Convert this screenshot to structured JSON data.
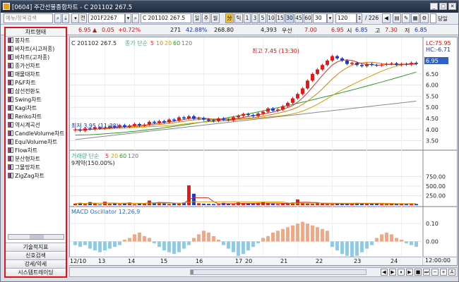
{
  "window": {
    "title": "[0604] 주간선물종합차트 - C 201102 267.5"
  },
  "toolbar": {
    "search_placeholder": "예뉴/항목검색",
    "mode_label": "전",
    "code_value": "201F2267",
    "name_value": "C 201102 267.5",
    "periods": [
      "일",
      "주",
      "월",
      "틱",
      "1",
      "3",
      "5",
      "10",
      "15",
      "30",
      "45",
      "60",
      "30"
    ],
    "count_value": "120",
    "total_count": "/ 226",
    "check_label": "당일"
  },
  "pricebar": {
    "price": "6.95",
    "change_arrow": "▲",
    "change": "0.05",
    "change_pct": "+0.72%",
    "volume": "271",
    "vol_pct": "42.88%",
    "amount": "268.80",
    "open_interest": "4,393",
    "priority_label": "우선",
    "priority_value": "7.00",
    "bid_value": "6.95",
    "low_label": "시",
    "low_value": "6.85",
    "high_label": "고",
    "high_value": "7.30",
    "close_label": "저",
    "close_value": "6.85"
  },
  "left_panel": {
    "header": "차트형태",
    "items": [
      "봉차트",
      "바차트(시고저종)",
      "바차트(고저종)",
      "종가선차트",
      "매물대차트",
      "P&F차트",
      "삼선전환도",
      "Swing차트",
      "Kagi차트",
      "Renko차트",
      "역시계곡선",
      "CandleVolume차트",
      "EquiVolume차트",
      "Flow차트",
      "분산형차트",
      "그물망차트",
      "ZigZag차트"
    ],
    "bottom_buttons": [
      "기술적지표",
      "신호검색",
      "강세/약세",
      "시스템트레이딩"
    ]
  },
  "chart_data": [
    {
      "type": "candlestick",
      "title": "C 201102 267.5",
      "legend": [
        "종가 단순",
        "5",
        "10",
        "20",
        "60",
        "120"
      ],
      "max_label": "최고 7.45 (13:30)",
      "min_label": "최저 3.95 (11:30)",
      "lc_label": "LC:75.95",
      "hc_label": "HC:-6.71",
      "last_price": "6.95",
      "y_ticks": [
        "6.50",
        "6.00",
        "5.50",
        "5.00",
        "4.50",
        "4.00",
        "3.50"
      ],
      "ylim": [
        3.2,
        7.7
      ],
      "closes": [
        4.0,
        3.95,
        4.05,
        4.02,
        4.1,
        4.05,
        4.08,
        4.15,
        4.1,
        4.2,
        4.12,
        4.18,
        4.25,
        4.18,
        4.22,
        4.35,
        4.3,
        4.38,
        4.32,
        4.45,
        4.4,
        4.55,
        4.5,
        4.6,
        4.48,
        4.52,
        4.45,
        4.4,
        4.38,
        4.5,
        4.45,
        4.42,
        4.55,
        4.62,
        4.7,
        4.65,
        4.6,
        4.72,
        4.8,
        4.95,
        4.85,
        4.9,
        5.05,
        5.2,
        5.4,
        5.6,
        5.85,
        6.2,
        6.5,
        6.7,
        6.9,
        7.1,
        7.3,
        7.2,
        7.1,
        6.95,
        7.0,
        6.9,
        6.85,
        6.95,
        6.9,
        6.88,
        6.92,
        6.95,
        6.98,
        6.9,
        6.95,
        6.92,
        7.0,
        6.95
      ]
    },
    {
      "type": "bar",
      "title": "거래량 단순",
      "legend": [
        "5",
        "20",
        "60",
        "120"
      ],
      "sub_label": "9계약(150.00%)",
      "y_ticks": [
        "750.00",
        "500.00",
        "250.00"
      ],
      "ylim": [
        0,
        1000
      ],
      "values": [
        40,
        60,
        30,
        80,
        50,
        20,
        90,
        35,
        60,
        30,
        45,
        70,
        25,
        55,
        40,
        120,
        60,
        80,
        45,
        30,
        65,
        40,
        70,
        520,
        300,
        50,
        40,
        35,
        30,
        25,
        60,
        45,
        30,
        70,
        55,
        40,
        35,
        60,
        80,
        50,
        40,
        30,
        45,
        60,
        70,
        150,
        55,
        40,
        35,
        60,
        45,
        30,
        25,
        50,
        35,
        40,
        30,
        60,
        45,
        55,
        35,
        40,
        30,
        25,
        50,
        40,
        30,
        35,
        40,
        30
      ]
    },
    {
      "type": "bar",
      "title": "MACD Oscillator 12,26,9",
      "y_ticks": [
        "0.10",
        "0.00"
      ],
      "ylim": [
        -0.12,
        0.14
      ],
      "values": [
        -0.02,
        -0.03,
        -0.02,
        -0.04,
        -0.05,
        -0.06,
        -0.05,
        -0.04,
        -0.03,
        -0.02,
        0.01,
        0.02,
        0.04,
        0.05,
        0.03,
        0.02,
        -0.01,
        -0.03,
        -0.05,
        -0.06,
        -0.07,
        -0.06,
        -0.04,
        -0.02,
        0.02,
        0.04,
        0.06,
        0.05,
        0.03,
        0.01,
        -0.02,
        -0.04,
        -0.06,
        -0.08,
        -0.07,
        -0.05,
        -0.03,
        -0.01,
        0.02,
        0.03,
        0.05,
        0.06,
        0.07,
        0.08,
        0.09,
        0.1,
        0.11,
        0.1,
        0.09,
        0.08,
        0.07,
        0.06,
        -0.03,
        -0.05,
        -0.07,
        -0.08,
        -0.09,
        -0.08,
        -0.06,
        -0.04,
        -0.02,
        0.02,
        0.04,
        0.05,
        0.04,
        0.02,
        0.01,
        -0.01,
        -0.02,
        -0.03
      ]
    }
  ],
  "x_axis": {
    "labels": [
      "12/10",
      "13",
      "14",
      "15",
      "16",
      "17",
      "20",
      "21",
      "22",
      "23",
      "24"
    ],
    "time_label": "12:00:00"
  }
}
